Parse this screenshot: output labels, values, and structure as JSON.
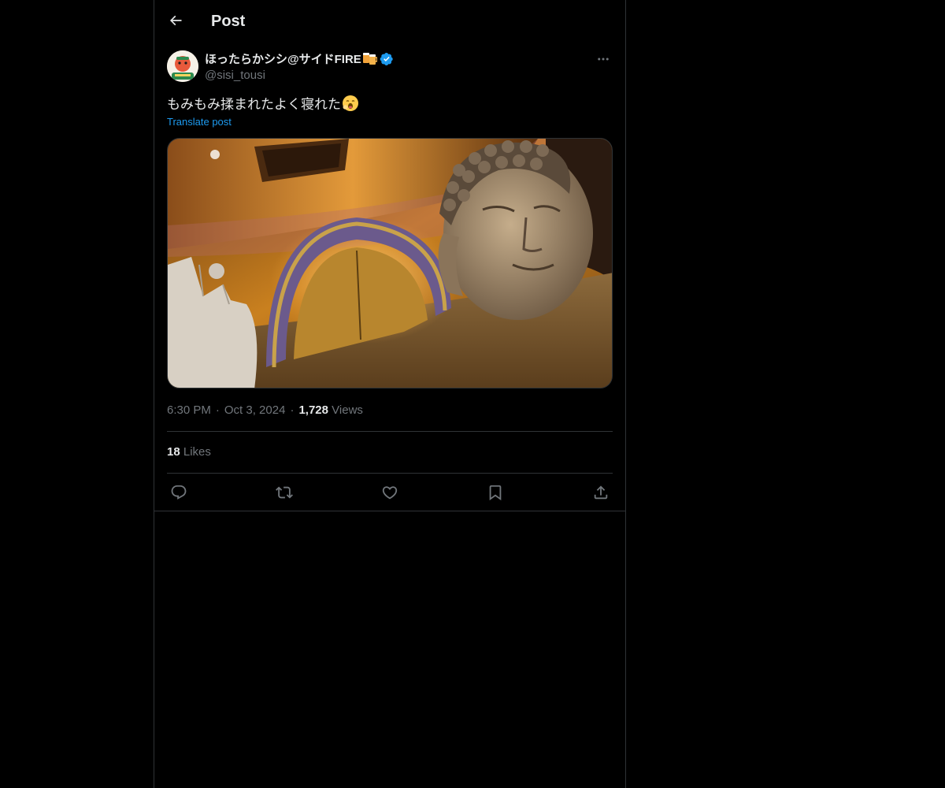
{
  "header": {
    "title": "Post",
    "back_icon": "arrow-left-icon"
  },
  "post": {
    "author": {
      "display_name": "ほったらかシシ@サイドFIRE",
      "name_emoji": "beer-mugs-emoji",
      "verified_icon": "verified-badge-icon",
      "handle": "@sisi_tousi"
    },
    "more_icon": "more-horizontal-icon",
    "text": "もみもみ揉まれたよく寝れた",
    "text_emoji": "yawning-face-emoji",
    "translate_label": "Translate post",
    "media": {
      "kind": "photo",
      "subject": "buddha-head-interior-photo"
    },
    "time": "6:30 PM",
    "date": "Oct 3, 2024",
    "views_count": "1,728",
    "views_label": "Views",
    "likes_count": "18",
    "likes_label": "Likes"
  },
  "actions": [
    {
      "name": "reply",
      "icon": "reply-icon"
    },
    {
      "name": "repost",
      "icon": "repost-icon"
    },
    {
      "name": "like",
      "icon": "heart-icon"
    },
    {
      "name": "bookmark",
      "icon": "bookmark-icon"
    },
    {
      "name": "share",
      "icon": "share-icon"
    }
  ],
  "colors": {
    "background": "#000000",
    "text_primary": "#e7e9ea",
    "text_secondary": "#71767b",
    "accent": "#1d9bf0",
    "border": "#2f3336"
  }
}
